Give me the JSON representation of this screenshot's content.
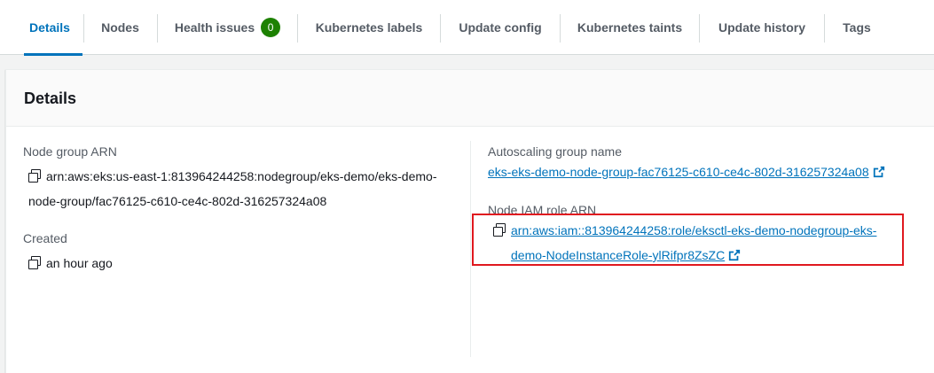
{
  "tabs": [
    {
      "label": "Details"
    },
    {
      "label": "Nodes"
    },
    {
      "label": "Health issues",
      "badge": "0"
    },
    {
      "label": "Kubernetes labels"
    },
    {
      "label": "Update config"
    },
    {
      "label": "Kubernetes taints"
    },
    {
      "label": "Update history"
    },
    {
      "label": "Tags"
    }
  ],
  "panel": {
    "title": "Details",
    "node_group_arn": {
      "label": "Node group ARN",
      "line1": "arn:aws:eks:us-east-1:813964244258:nodegroup/eks-demo/eks-demo-",
      "line2": "node-group/fac76125-c610-ce4c-802d-316257324a08"
    },
    "created": {
      "label": "Created",
      "value": "an hour ago"
    },
    "autoscaling_group": {
      "label": "Autoscaling group name",
      "value": "eks-eks-demo-node-group-fac76125-c610-ce4c-802d-316257324a08"
    },
    "node_iam_role": {
      "label": "Node IAM role ARN",
      "line1": "arn:aws:iam::813964244258:role/eksctl-eks-demo-nodegroup-eks-",
      "line2": "demo-NodeInstanceRole-ylRifpr8ZsZC"
    }
  },
  "colors": {
    "accent": "#0073bb",
    "badge": "#1d8102",
    "highlight": "#e0191f"
  },
  "icons": [
    "copy-icon",
    "external-link-icon"
  ]
}
